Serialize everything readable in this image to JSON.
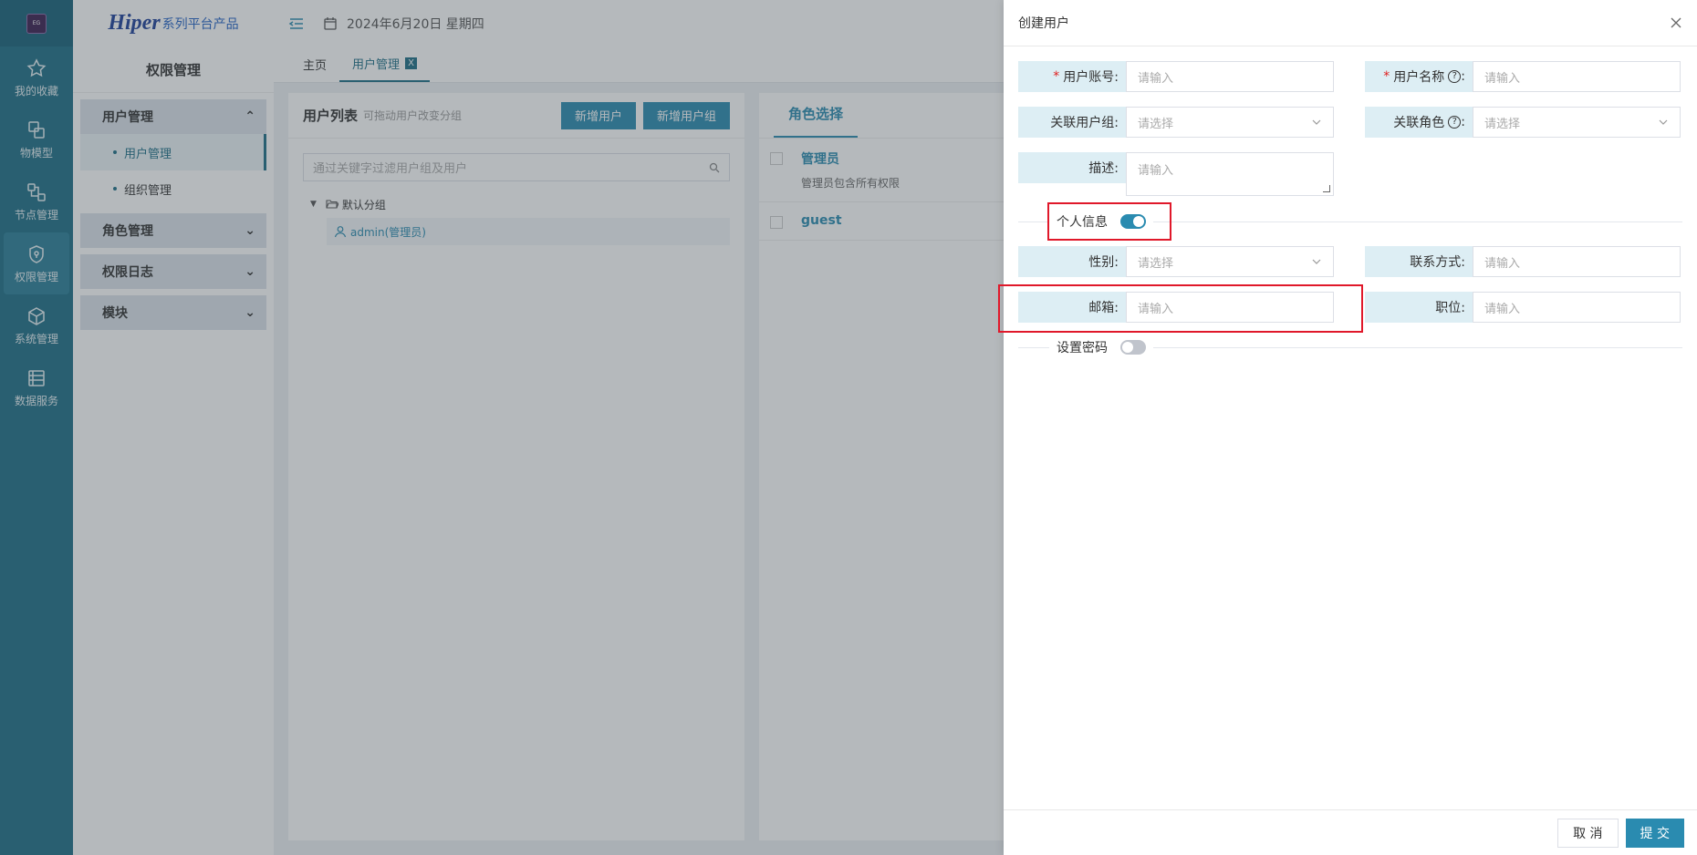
{
  "header": {
    "brand_main": "Hiper",
    "brand_sub": "系列平台产品",
    "date_text": "2024年6月20日 星期四"
  },
  "rail": {
    "logo_text": "EG",
    "items": [
      {
        "label": "我的收藏",
        "icon": "star-icon"
      },
      {
        "label": "物模型",
        "icon": "model-icon"
      },
      {
        "label": "节点管理",
        "icon": "node-icon"
      },
      {
        "label": "权限管理",
        "icon": "shield-icon"
      },
      {
        "label": "系统管理",
        "icon": "cube-icon"
      },
      {
        "label": "数据服务",
        "icon": "database-icon"
      }
    ]
  },
  "sidebar": {
    "title": "权限管理",
    "groups": [
      {
        "label": "用户管理",
        "expanded": true,
        "children": [
          "用户管理",
          "组织管理"
        ]
      },
      {
        "label": "角色管理"
      },
      {
        "label": "权限日志"
      },
      {
        "label": "模块"
      }
    ]
  },
  "tabs": {
    "home": "主页",
    "current": "用户管理",
    "close": "X"
  },
  "user_list": {
    "title": "用户列表",
    "hint": "可拖动用户改变分组",
    "add_user": "新增用户",
    "add_group": "新增用户组",
    "search_placeholder": "通过关键字过滤用户组及用户",
    "group_name": "默认分组",
    "user": "admin(管理员)"
  },
  "roles": {
    "tab": "角色选择",
    "items": [
      {
        "name": "管理员",
        "desc": "管理员包含所有权限"
      },
      {
        "name": "guest",
        "desc": ""
      }
    ]
  },
  "drawer": {
    "title": "创建用户",
    "fields": {
      "account": {
        "label": "用户账号:",
        "placeholder": "请输入"
      },
      "name": {
        "label": "用户名称",
        "placeholder": "请输入"
      },
      "group": {
        "label": "关联用户组:",
        "placeholder": "请选择"
      },
      "role": {
        "label": "关联角色",
        "placeholder": "请选择"
      },
      "desc": {
        "label": "描述:",
        "placeholder": "请输入"
      },
      "gender": {
        "label": "性别:",
        "placeholder": "请选择"
      },
      "contact": {
        "label": "联系方式:",
        "placeholder": "请输入"
      },
      "email": {
        "label": "邮箱:",
        "placeholder": "请输入"
      },
      "position": {
        "label": "职位:",
        "placeholder": "请输入"
      }
    },
    "personal_info": {
      "label": "个人信息",
      "on": true
    },
    "set_password": {
      "label": "设置密码",
      "on": false
    },
    "help_glyph": "?",
    "colon": ":",
    "required_mark": "*",
    "cancel": "取 消",
    "submit": "提 交"
  },
  "colors": {
    "rail": "#1d6e86",
    "accent": "#2a8bb0",
    "label_bg": "#ddeef4",
    "highlight": "#e0182a"
  }
}
